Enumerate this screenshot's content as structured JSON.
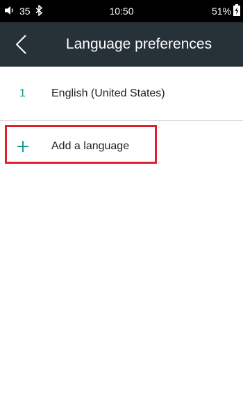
{
  "status_bar": {
    "volume_level": "35",
    "time": "10:50",
    "battery": "51%"
  },
  "app_bar": {
    "title": "Language preferences"
  },
  "languages": [
    {
      "index": "1",
      "name": "English (United States)"
    }
  ],
  "add_language": {
    "label": "Add a language"
  },
  "colors": {
    "app_bar_bg": "#263238",
    "accent": "#199a8e",
    "highlight": "#e02030"
  },
  "icons": [
    "volume-icon",
    "bluetooth-icon",
    "battery-charging-icon",
    "back-arrow-icon",
    "plus-icon"
  ]
}
